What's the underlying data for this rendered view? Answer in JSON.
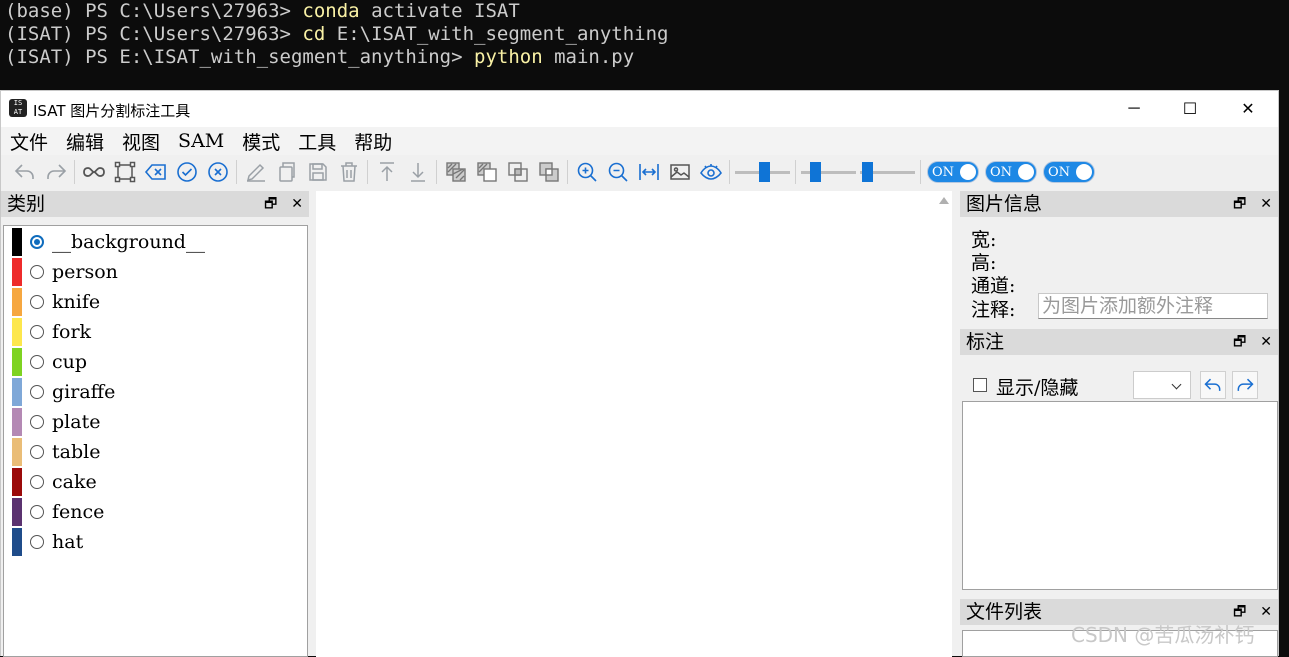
{
  "terminal": {
    "lines": [
      {
        "prefix": "(base) PS C:\\Users\\27963> ",
        "cmd": "conda",
        "rest": " activate ISAT"
      },
      {
        "prefix": "(ISAT) PS C:\\Users\\27963> ",
        "cmd": "cd",
        "rest": " E:\\ISAT_with_segment_anything"
      },
      {
        "prefix": "(ISAT) PS E:\\ISAT_with_segment_anything> ",
        "cmd": "python",
        "rest": " main.py"
      }
    ]
  },
  "window": {
    "title": "ISAT 图片分割标注工具",
    "icon_text": "IS AT",
    "controls": {
      "minimize": "─",
      "maximize": "☐",
      "close": "✕"
    }
  },
  "menu": [
    "文件",
    "编辑",
    "视图",
    "SAM",
    "模式",
    "工具",
    "帮助"
  ],
  "toolbar": {
    "toggles": [
      "ON",
      "ON",
      "ON"
    ],
    "sliders": [
      0.55,
      0.2,
      0.05
    ]
  },
  "category_panel": {
    "title": "类别",
    "items": [
      {
        "label": "__background__",
        "color": "#000000",
        "selected": true
      },
      {
        "label": "person",
        "color": "#ee2b2b",
        "selected": false
      },
      {
        "label": "knife",
        "color": "#f6a740",
        "selected": false
      },
      {
        "label": "fork",
        "color": "#fde74c",
        "selected": false
      },
      {
        "label": "cup",
        "color": "#7ed321",
        "selected": false
      },
      {
        "label": "giraffe",
        "color": "#7fa8d8",
        "selected": false
      },
      {
        "label": "plate",
        "color": "#b489b4",
        "selected": false
      },
      {
        "label": "table",
        "color": "#eabd77",
        "selected": false
      },
      {
        "label": "cake",
        "color": "#9b0a0a",
        "selected": false
      },
      {
        "label": "fence",
        "color": "#5b3270",
        "selected": false
      },
      {
        "label": "hat",
        "color": "#1f4c8a",
        "selected": false
      }
    ]
  },
  "image_info": {
    "title": "图片信息",
    "width_label": "宽:",
    "height_label": "高:",
    "channel_label": "通道:",
    "note_label": "注释:",
    "note_placeholder": "为图片添加额外注释"
  },
  "annotation_panel": {
    "title": "标注",
    "show_hide_label": "显示/隐藏"
  },
  "file_list_panel": {
    "title": "文件列表"
  },
  "dock_buttons": {
    "float": "🗗",
    "close": "✕"
  },
  "watermark": "CSDN @苦瓜汤补钙"
}
